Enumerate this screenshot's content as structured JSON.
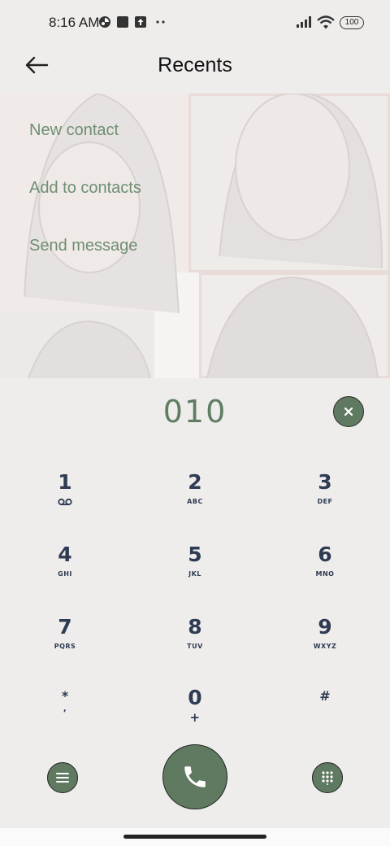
{
  "status_bar": {
    "time": "8:16 AM",
    "battery": "100",
    "icons": [
      "circle-status-icon",
      "square-notification-icon",
      "upload-icon",
      "more-dots-icon",
      "signal-icon",
      "wifi-icon"
    ]
  },
  "header": {
    "back_icon": "arrow-left-icon",
    "title": "Recents"
  },
  "menu": {
    "items": [
      "New contact",
      "Add to contacts",
      "Send message"
    ]
  },
  "dialer": {
    "number": "010",
    "clear_icon": "close-icon",
    "keys": [
      {
        "digit": "1",
        "letters": "voicemail-icon"
      },
      {
        "digit": "2",
        "letters": "ABC"
      },
      {
        "digit": "3",
        "letters": "DEF"
      },
      {
        "digit": "4",
        "letters": "GHI"
      },
      {
        "digit": "5",
        "letters": "JKL"
      },
      {
        "digit": "6",
        "letters": "MNO"
      },
      {
        "digit": "7",
        "letters": "PQRS"
      },
      {
        "digit": "8",
        "letters": "TUV"
      },
      {
        "digit": "9",
        "letters": "WXYZ"
      },
      {
        "digit": "*",
        "letters": ","
      },
      {
        "digit": "0",
        "letters": "+"
      },
      {
        "digit": "#",
        "letters": ""
      }
    ]
  },
  "bottom": {
    "menu_icon": "menu-icon",
    "call_icon": "phone-icon",
    "keypad_icon": "keypad-grid-icon"
  },
  "colors": {
    "accent": "#5f7a60",
    "menu_text": "#6f8f72",
    "digit_text": "#2e3b52",
    "background": "#efedec"
  }
}
